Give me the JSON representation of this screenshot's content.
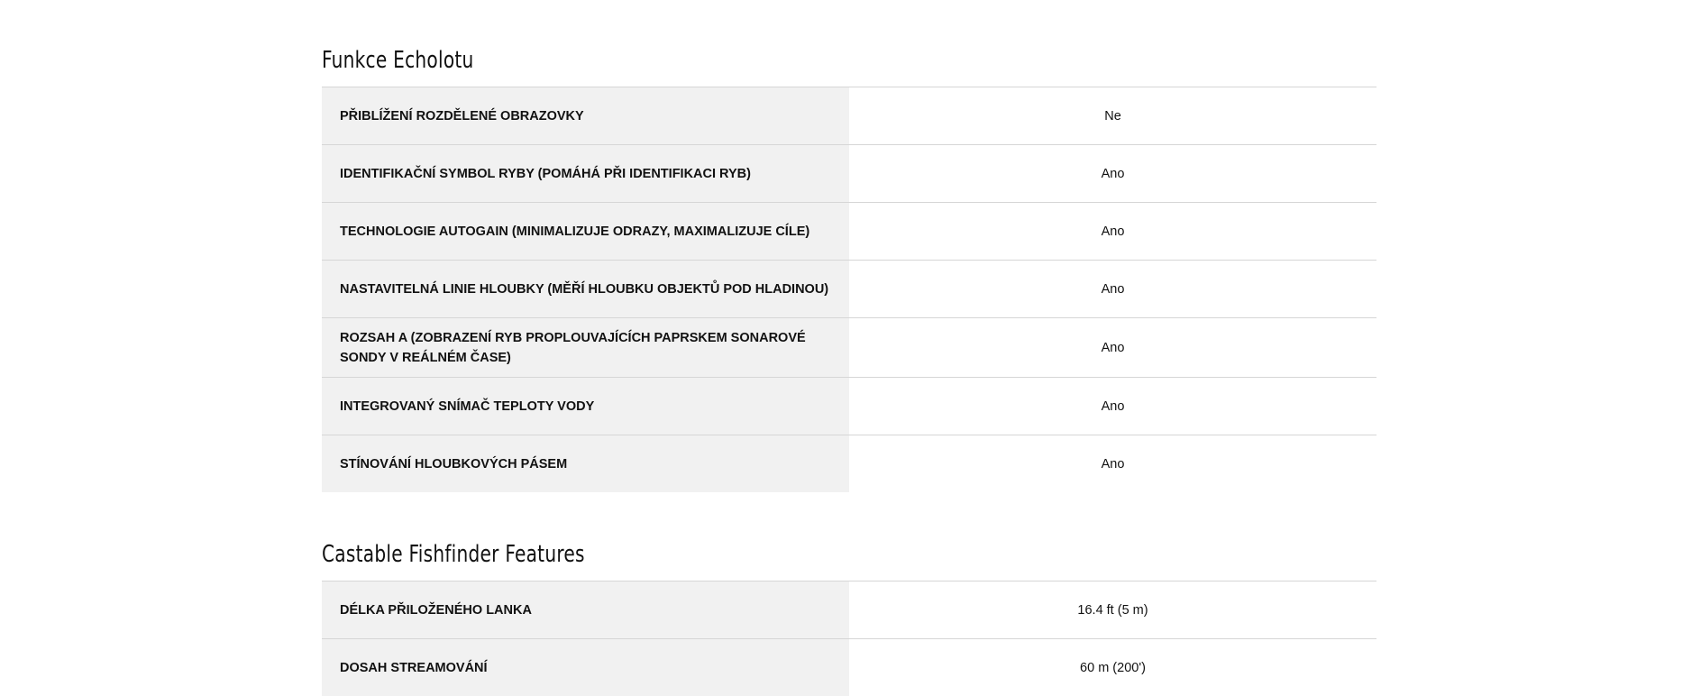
{
  "sections": [
    {
      "title": "Funkce Echolotu",
      "rows": [
        {
          "label": "PŘIBLÍŽENÍ ROZDĚLENÉ OBRAZOVKY",
          "value": "Ne"
        },
        {
          "label": "IDENTIFIKAČNÍ SYMBOL RYBY (POMÁHÁ PŘI IDENTIFIKACI RYB)",
          "value": "Ano"
        },
        {
          "label": "TECHNOLOGIE AUTOGAIN (MINIMALIZUJE ODRAZY, MAXIMALIZUJE CÍLE)",
          "value": "Ano"
        },
        {
          "label": "NASTAVITELNÁ LINIE HLOUBKY (MĚŘÍ HLOUBKU OBJEKTŮ POD HLADINOU)",
          "value": "Ano"
        },
        {
          "label": "ROZSAH A (ZOBRAZENÍ RYB PROPLOUVAJÍCÍCH PAPRSKEM SONAROVÉ SONDY V REÁLNÉM ČASE)",
          "value": "Ano"
        },
        {
          "label": "INTEGROVANÝ SNÍMAČ TEPLOTY VODY",
          "value": "Ano"
        },
        {
          "label": "STÍNOVÁNÍ HLOUBKOVÝCH PÁSEM",
          "value": "Ano"
        }
      ]
    },
    {
      "title": "Castable Fishfinder Features",
      "rows": [
        {
          "label": "DÉLKA PŘILOŽENÉHO LANKA",
          "value": "16.4 ft (5 m)"
        },
        {
          "label": "DOSAH STREAMOVÁNÍ",
          "value": "60 m (200')"
        }
      ]
    }
  ]
}
